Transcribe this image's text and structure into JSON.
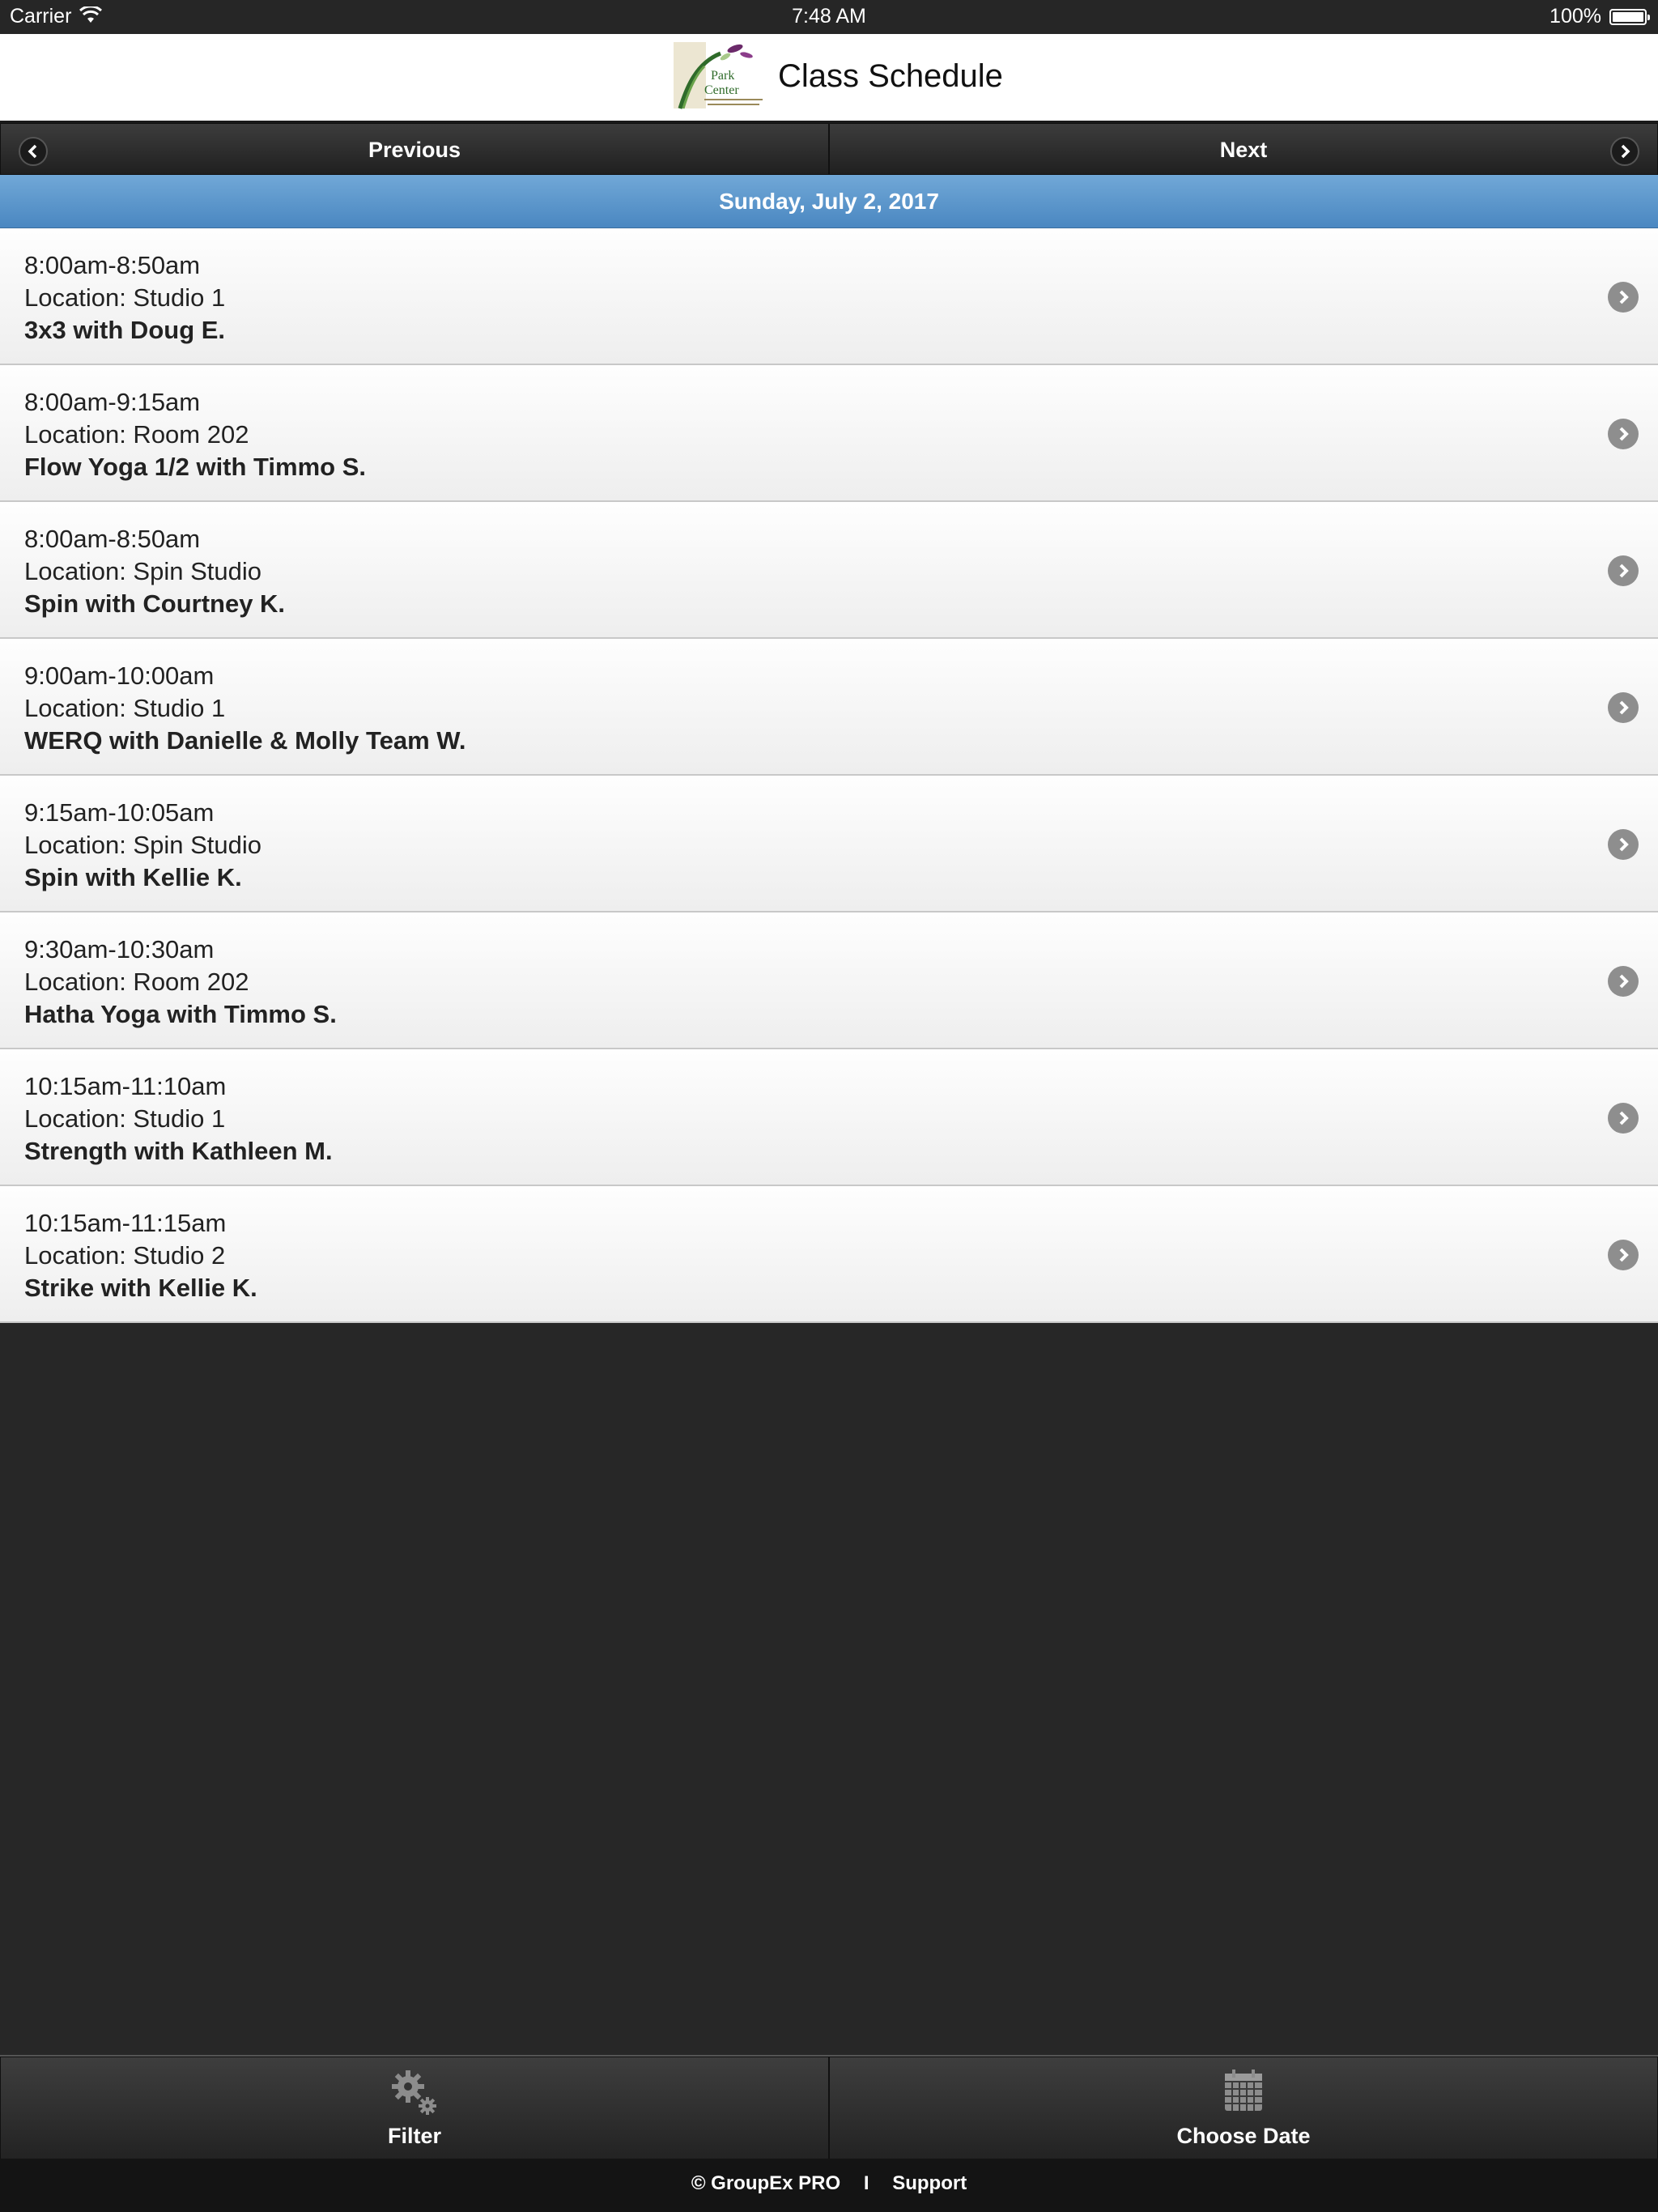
{
  "status_bar": {
    "carrier": "Carrier",
    "time": "7:48 AM",
    "battery": "100%"
  },
  "header": {
    "title": "Class Schedule",
    "logo_icon": "park-center-logo"
  },
  "nav": {
    "previous_label": "Previous",
    "next_label": "Next"
  },
  "date_label": "Sunday, July 2, 2017",
  "classes": [
    {
      "time": "8:00am-8:50am",
      "location": "Location: Studio 1",
      "title": "3x3 with Doug E."
    },
    {
      "time": "8:00am-9:15am",
      "location": "Location: Room 202",
      "title": "Flow Yoga 1/2 with Timmo S."
    },
    {
      "time": "8:00am-8:50am",
      "location": "Location: Spin Studio",
      "title": "Spin with Courtney K."
    },
    {
      "time": "9:00am-10:00am",
      "location": "Location: Studio 1",
      "title": "WERQ with Danielle & Molly Team W."
    },
    {
      "time": "9:15am-10:05am",
      "location": "Location: Spin Studio",
      "title": "Spin with Kellie K."
    },
    {
      "time": "9:30am-10:30am",
      "location": "Location: Room 202",
      "title": "Hatha Yoga with Timmo S."
    },
    {
      "time": "10:15am-11:10am",
      "location": "Location: Studio 1",
      "title": "Strength with Kathleen M."
    },
    {
      "time": "10:15am-11:15am",
      "location": "Location: Studio 2",
      "title": "Strike with Kellie K."
    }
  ],
  "toolbar": {
    "filter_label": "Filter",
    "choose_date_label": "Choose Date"
  },
  "footer": {
    "copyright": "© GroupEx PRO",
    "separator": "I",
    "support": "Support"
  },
  "colors": {
    "date_bar": "#5b97cd",
    "background": "#272727"
  }
}
